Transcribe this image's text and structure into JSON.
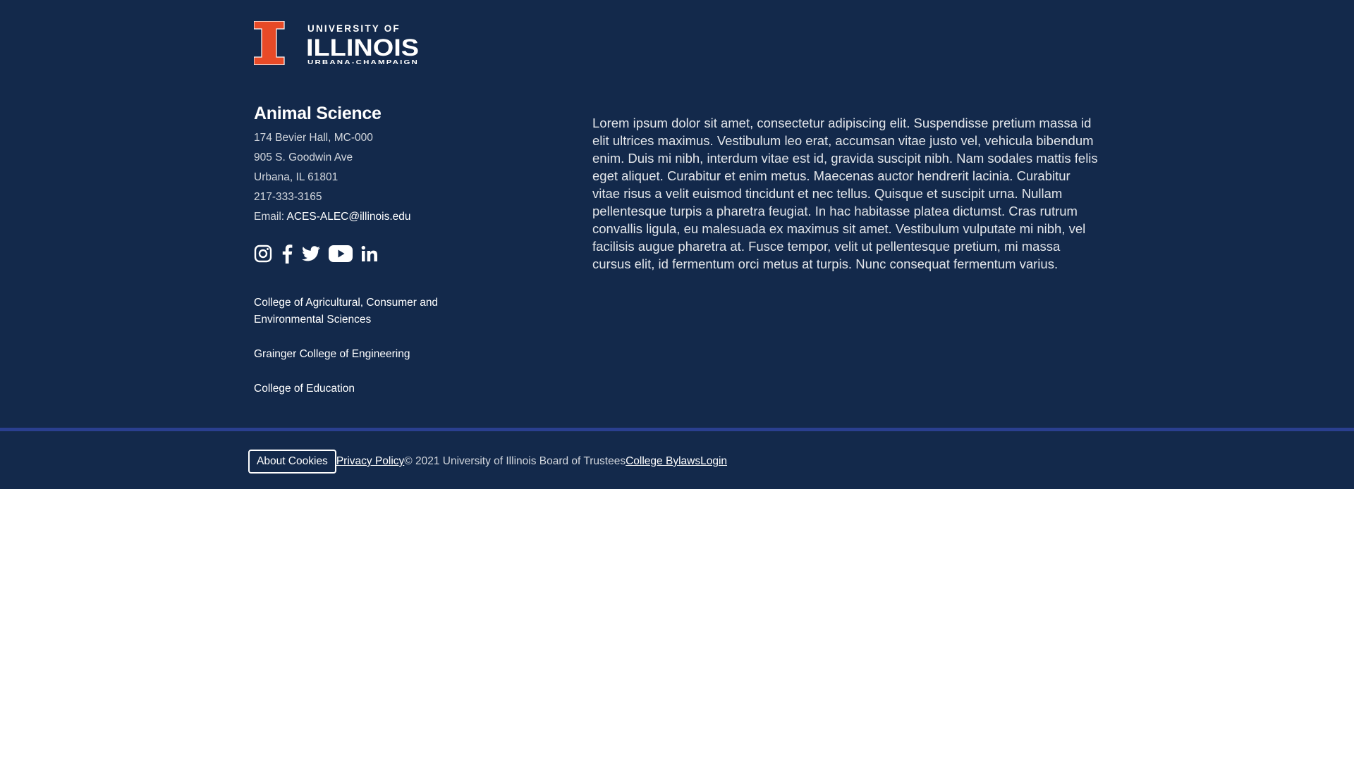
{
  "colors": {
    "navy": "#13294b",
    "orange": "#e84a27",
    "divider": "#2a3f8f"
  },
  "logo": {
    "line1": "UNIVERSITY OF",
    "line2": "ILLINOIS",
    "line3": "URBANA-CHAMPAIGN"
  },
  "unit": {
    "name": "Animal Science",
    "address_lines": [
      "174 Bevier Hall, MC-000",
      "905 S. Goodwin Ave",
      "Urbana, IL 61801"
    ],
    "phone": "217-333-3165",
    "email_label": "Email: ",
    "email": "ACES-ALEC@illinois.edu"
  },
  "social": [
    {
      "icon": "instagram-icon"
    },
    {
      "icon": "facebook-icon"
    },
    {
      "icon": "twitter-icon"
    },
    {
      "icon": "youtube-icon"
    },
    {
      "icon": "linkedin-icon"
    }
  ],
  "college_links": [
    "College of Agricultural, Consumer and Environmental Sciences",
    "Grainger College of Engineering",
    "College of Education"
  ],
  "lorem": "Lorem ipsum dolor sit amet, consectetur adipiscing elit. Suspendisse pretium massa id elit ultrices maximus. Vestibulum leo erat, accumsan vitae justo vel, vehicula bibendum enim. Duis mi nibh, interdum vitae est id, gravida suscipit nibh. Nam sodales mattis felis eget aliquet. Curabitur et enim metus. Maecenas auctor hendrerit lacinia. Curabitur vitae risus a velit euismod tincidunt et nec tellus. Quisque et suscipit urna. Nullam pellentesque turpis a pharetra feugiat. In hac habitasse platea dictumst. Cras rutrum convallis ligula, eu malesuada ex maximus sit amet. Vestibulum vulputate mi nibh, vel facilisis augue pharetra at. Fusce tempor, velit ut pellentesque pretium, mi massa cursus elit, id fermentum orci metus at turpis. Nunc consequat fermentum varius.",
  "bottom": {
    "cookies_button": "About Cookies",
    "privacy": "Privacy Policy",
    "copyright": "© 2021 University of Illinois Board of Trustees",
    "bylaws": "College Bylaws",
    "login": "Login"
  }
}
